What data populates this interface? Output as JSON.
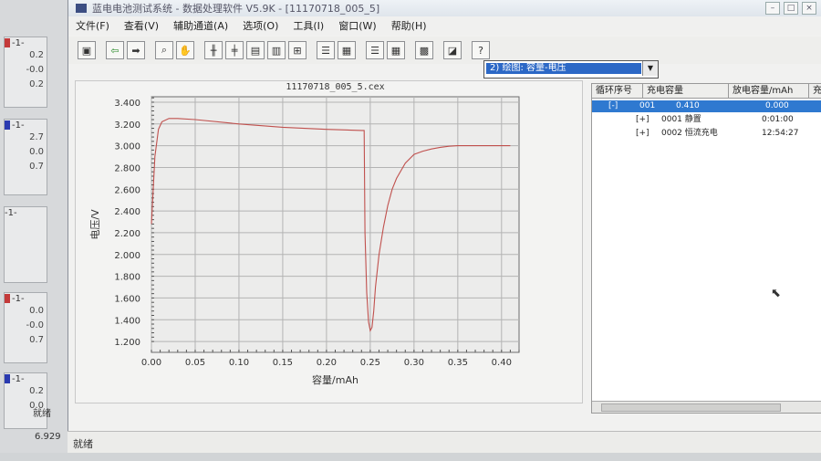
{
  "window": {
    "title": "蓝电电池测试系统 - 数据处理软件 V5.9K - [11170718_005_5]"
  },
  "menu": [
    "文件(F)",
    "查看(V)",
    "辅助通道(A)",
    "选项(O)",
    "工具(I)",
    "窗口(W)",
    "帮助(H)"
  ],
  "toolbar_icons": [
    "open-folder-icon",
    "arrow-left-icon",
    "arrow-right-icon",
    "zoom-icon",
    "hand-icon",
    "grid-a-icon",
    "grid-b-icon",
    "grid-c-icon",
    "grid-d-icon",
    "grid-e-icon",
    "list-a-icon",
    "list-b-icon",
    "list-c-icon",
    "list-d-icon",
    "table-icon",
    "chart-icon",
    "help-icon"
  ],
  "view_select": {
    "value": "2) 绘图: 容量-电压"
  },
  "chart_data": {
    "type": "line",
    "title": "11170718_005_5.cex",
    "xlabel": "容量/mAh",
    "ylabel": "电压/V",
    "xlim": [
      0.0,
      0.42
    ],
    "ylim": [
      1.1,
      3.45
    ],
    "x_ticks": [
      "0.00",
      "0.05",
      "0.10",
      "0.15",
      "0.20",
      "0.25",
      "0.30",
      "0.35",
      "0.40"
    ],
    "y_ticks": [
      "3.400",
      "3.200",
      "3.000",
      "2.800",
      "2.600",
      "2.400",
      "2.200",
      "2.000",
      "1.800",
      "1.600",
      "1.400",
      "1.200"
    ],
    "grid": true,
    "series": [
      {
        "color": "#c0504d",
        "x": [
          0.0,
          0.004,
          0.008,
          0.012,
          0.02,
          0.03,
          0.05,
          0.1,
          0.15,
          0.2,
          0.24,
          0.243,
          0.244,
          0.246,
          0.248,
          0.25,
          0.252,
          0.254,
          0.256,
          0.26,
          0.265,
          0.27,
          0.275,
          0.28,
          0.29,
          0.3,
          0.31,
          0.32,
          0.33,
          0.34,
          0.35,
          0.36,
          0.37,
          0.38,
          0.39,
          0.4,
          0.41
        ],
        "y": [
          2.28,
          2.9,
          3.15,
          3.22,
          3.25,
          3.25,
          3.24,
          3.2,
          3.17,
          3.15,
          3.14,
          3.14,
          2.2,
          1.65,
          1.38,
          1.3,
          1.33,
          1.48,
          1.7,
          2.0,
          2.25,
          2.45,
          2.6,
          2.7,
          2.84,
          2.92,
          2.95,
          2.97,
          2.985,
          2.995,
          3.0,
          3.0,
          3.0,
          3.0,
          3.0,
          3.0,
          3.0
        ]
      }
    ]
  },
  "list": {
    "headers": [
      "循环序号",
      "充电容量",
      "放电容量/mAh",
      "充"
    ],
    "rows": [
      {
        "c1": "[-]",
        "c2": "001",
        "c3": "0.410",
        "c4": "0.000"
      },
      {
        "c1": "[+]",
        "c2": "0001 静置",
        "c3": "",
        "c4": "0:01:00"
      },
      {
        "c1": "[+]",
        "c2": "0002 恒流充电",
        "c3": "",
        "c4": "12:54:27"
      }
    ]
  },
  "status": {
    "text": "就绪"
  },
  "background": {
    "panel_label": "-1-",
    "panel_values": [
      "0.2",
      "-0.0",
      "0.2",
      "2.7",
      "0.0",
      "0.7",
      "0.0",
      "-0.0",
      "0.7",
      "0.2",
      "0.0"
    ],
    "status": "就绪",
    "number": "6.929"
  }
}
